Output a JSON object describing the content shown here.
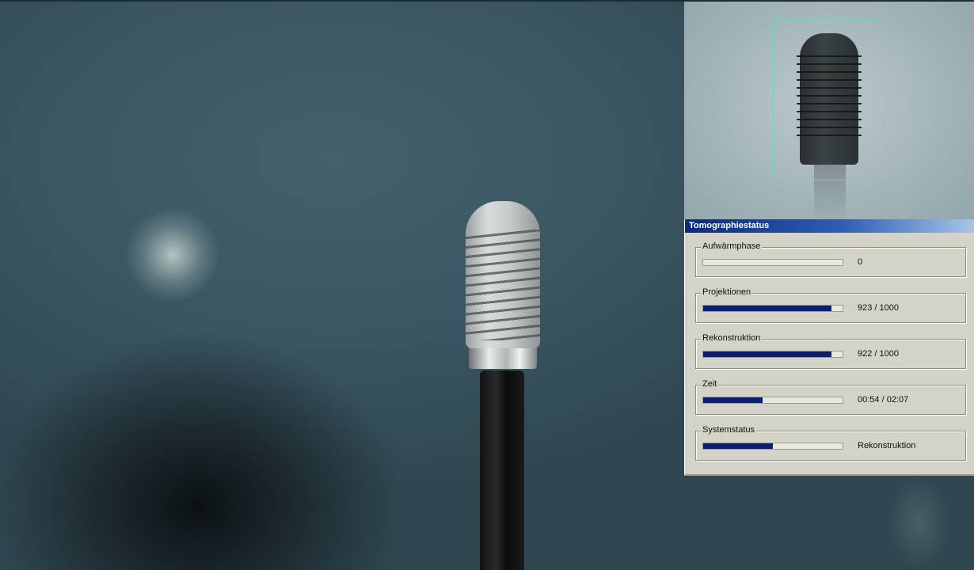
{
  "dialog": {
    "title": "Tomographiestatus",
    "groups": [
      {
        "label": "Aufwärmphase",
        "value": "0",
        "progress": 0.0
      },
      {
        "label": "Projektionen",
        "value": "923 / 1000",
        "progress": 0.923
      },
      {
        "label": "Rekonstruktion",
        "value": "922 / 1000",
        "progress": 0.922
      },
      {
        "label": "Zeit",
        "value": "00:54 / 02:07",
        "progress": 0.425
      },
      {
        "label": "Systemstatus",
        "value": "Rekonstruktion",
        "progress": 0.5
      }
    ]
  },
  "colors": {
    "progress_fill": "#0e1f6a",
    "titlebar_start": "#0b2a78",
    "roi_border": "#6fd9b0"
  }
}
